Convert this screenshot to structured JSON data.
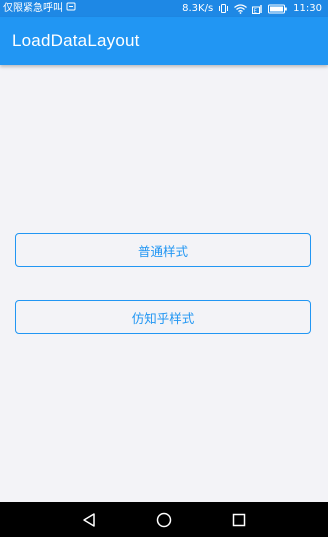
{
  "status_bar": {
    "carrier_text": "仅限紧急呼叫",
    "network_speed": "8.3K/s",
    "time": "11:30",
    "icons": [
      "sim-icon",
      "vibrate-icon",
      "wifi-icon",
      "signal-icon",
      "battery-icon"
    ]
  },
  "app_bar": {
    "title": "LoadDataLayout",
    "color": "#2196f3"
  },
  "main": {
    "buttons": [
      {
        "label": "普通样式"
      },
      {
        "label": "仿知乎样式"
      }
    ],
    "background": "#f3f3f7",
    "accent": "#2196f3"
  },
  "nav_bar": {
    "icons": [
      "back-icon",
      "home-icon",
      "recents-icon"
    ]
  }
}
